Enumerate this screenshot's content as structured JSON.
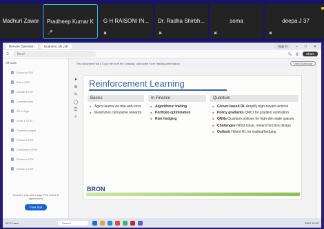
{
  "participants": [
    {
      "name": "Madhuri Zawar",
      "active": false
    },
    {
      "name": "Pradheep Kumar K",
      "active": true
    },
    {
      "name": "G H RAISONI IN...",
      "active": false
    },
    {
      "name": "Dr. Radha Shirbh...",
      "active": false
    },
    {
      "name": "soma",
      "active": false
    },
    {
      "name": "deepa J 37",
      "active": false
    }
  ],
  "browser": {
    "tab1": "Remote Operation",
    "tab2": "Quantum_ML.pdf",
    "signin": "Sign in",
    "address": "file:///",
    "share": "Share",
    "notice": "This document has a Copy file from the Desktop, and some more reading information",
    "notice_btn": "View Summary"
  },
  "sidebar": {
    "head": "All tools",
    "items": [
      "Export a PDF",
      "Edit a PDF",
      "Create a PDF",
      "Combine files",
      "Fill & Sign",
      "Scan & OCR",
      "Organize pages",
      "Protect a PDF",
      "Compress a PDF",
      "Redact a PDF",
      "Redact a PDF"
    ],
    "promo": "Convert, edit and e-sign PDF forms & agreements",
    "try_button": "Free trial"
  },
  "slide": {
    "title": "Reinforcement Learning",
    "columns": [
      {
        "header": "Basics",
        "items": [
          {
            "bold": "",
            "text": "Agent learns via trial-and-error"
          },
          {
            "bold": "",
            "text": "Maximizes cumulative rewards"
          }
        ]
      },
      {
        "header": "In Finance",
        "items": [
          {
            "bold": "Algorithmic trading",
            "text": ""
          },
          {
            "bold": "Portfolio optimization",
            "text": ""
          },
          {
            "bold": "Risk hedging",
            "text": ""
          }
        ]
      },
      {
        "header": "Quantum",
        "items": [
          {
            "bold": "Grover-based RL",
            "text": " Amplify high-reward actions"
          },
          {
            "bold": "Policy gradients",
            "text": " QMCI for gradient estimation"
          },
          {
            "bold": "QNNs",
            "text": " Quantum policies for high-dim state spaces"
          },
          {
            "bold": "Challenges",
            "text": " NISQ noise, reward function design"
          },
          {
            "bold": "Outlook",
            "text": " Hybrid RL for trading/hedging"
          }
        ]
      }
    ],
    "logo": "BRON"
  },
  "taskbar": {
    "weather": "26°C Haze",
    "search": "Search",
    "tray": "ENG 11:05"
  }
}
